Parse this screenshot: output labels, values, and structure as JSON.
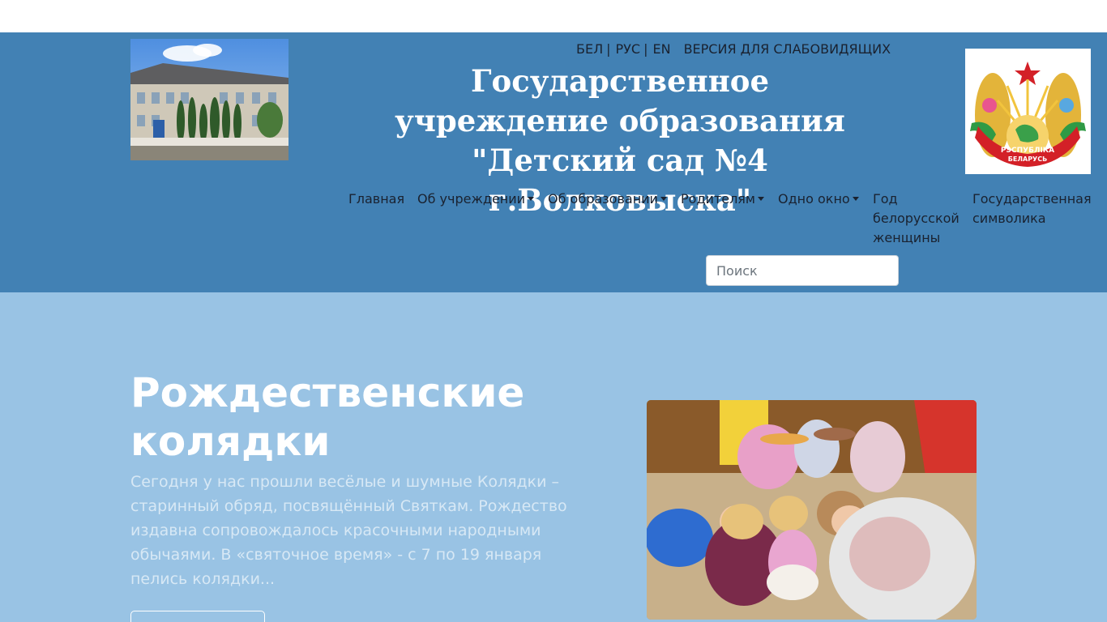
{
  "languages": [
    {
      "label": "БЕЛ",
      "separator": "|"
    },
    {
      "label": "РУС",
      "separator": "|"
    },
    {
      "label": "EN",
      "separator": ""
    }
  ],
  "low_vision_label": "ВЕРСИЯ ДЛЯ СЛАБОВИДЯЩИХ",
  "site_title": "Государственное учреждение образования \"Детский сад №4 г.Волковыска\"",
  "emblem_text": {
    "line1": "РЭСПУБЛІКА",
    "line2": "БЕЛАРУСЬ"
  },
  "nav": {
    "home": "Главная",
    "about": "Об учреждении",
    "education": "Об образовании",
    "parents": "Родителям",
    "one_window": "Одно окно",
    "year_women": "Год белорусской женщины",
    "symbols": "Государственная символика"
  },
  "search": {
    "placeholder": "Поиск"
  },
  "hero": {
    "title": "Рождественские колядки",
    "text": "Сегодня у нас прошли весёлые и шумные Колядки – старинный обряд, посвящённый Святкам. Рождество издавна сопровождалось красочными народными обычаями. В «святочное время» - с 7 по 19 января пелись колядки..."
  },
  "colors": {
    "header_bg": "#4281b4",
    "hero_bg": "#99c3e4",
    "nav_text": "#1a2230"
  }
}
